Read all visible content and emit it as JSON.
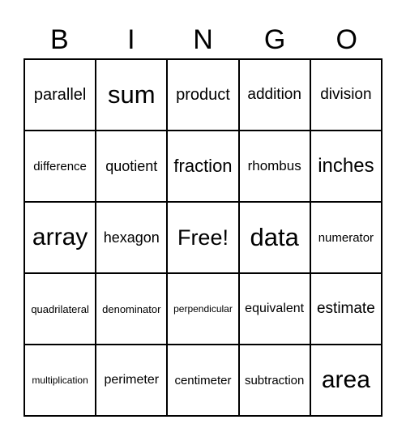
{
  "header": [
    "B",
    "I",
    "N",
    "G",
    "O"
  ],
  "rows": [
    [
      "parallel",
      "sum",
      "product",
      "addition",
      "division"
    ],
    [
      "difference",
      "quotient",
      "fraction",
      "rhombus",
      "inches"
    ],
    [
      "array",
      "hexagon",
      "Free!",
      "data",
      "numerator"
    ],
    [
      "quadrilateral",
      "denominator",
      "perpendicular",
      "equivalent",
      "estimate"
    ],
    [
      "multiplication",
      "perimeter",
      "centimeter",
      "subtraction",
      "area"
    ]
  ]
}
